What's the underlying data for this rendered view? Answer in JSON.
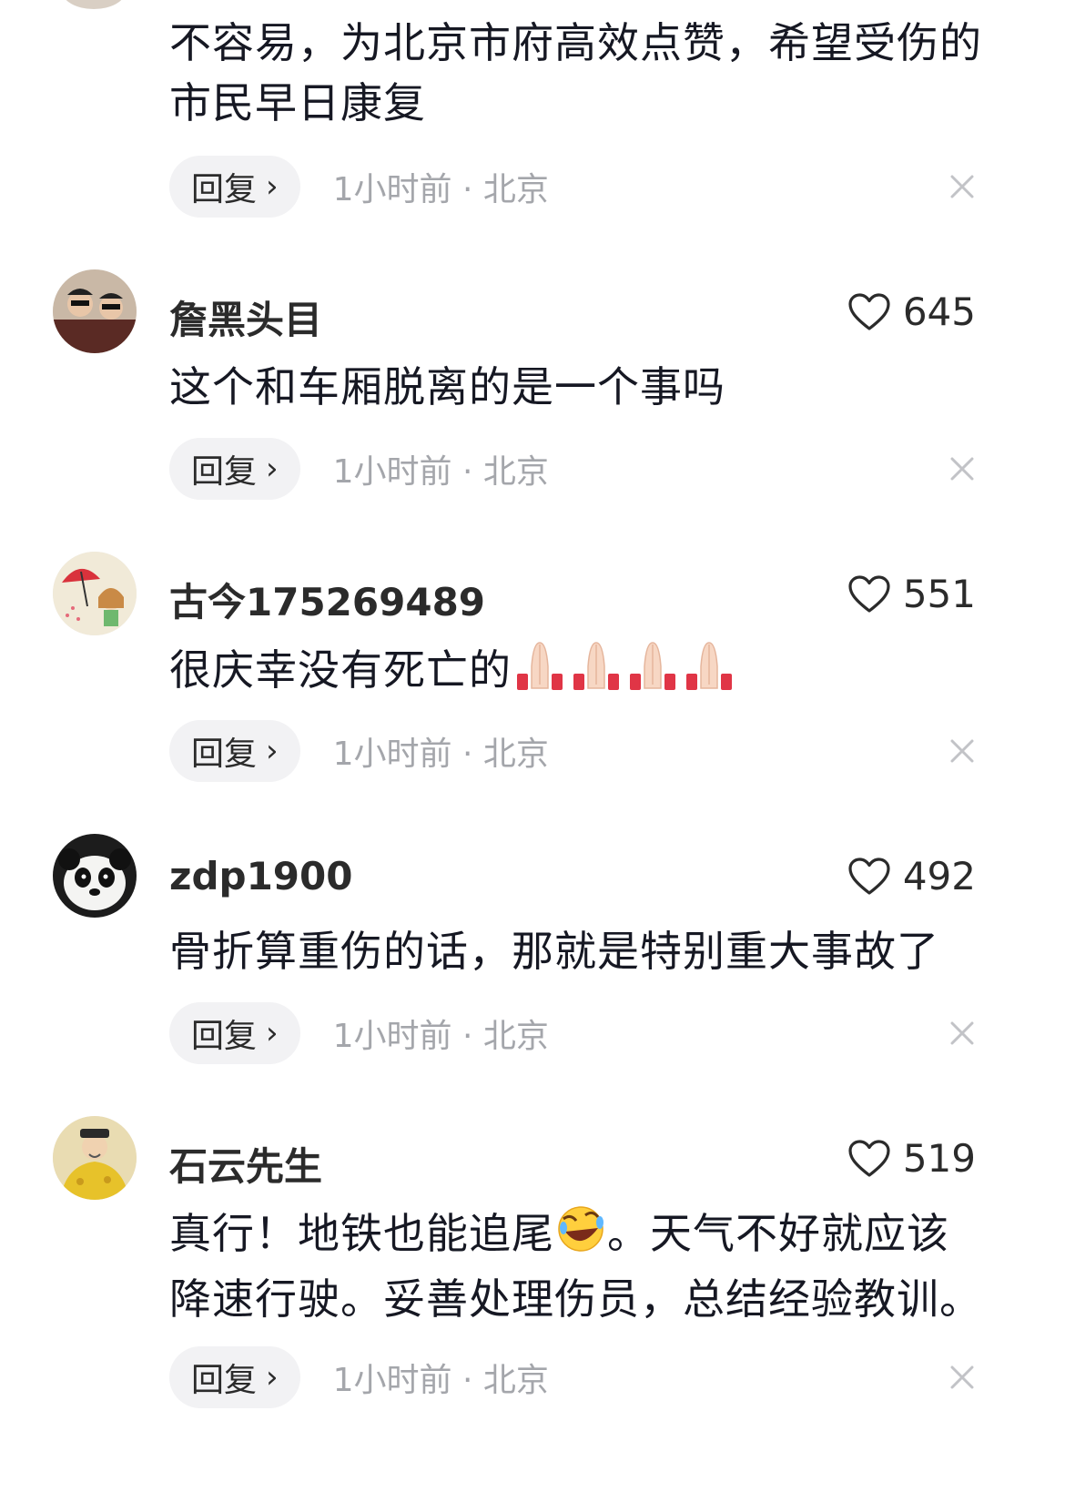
{
  "reply_label": "回复",
  "chevron_glyph": "›",
  "comments": [
    {
      "username": "",
      "likes": "",
      "text": "不容易，为北京市府高效点赞，希望受伤的市民早日康复",
      "time_location": "1小时前 · 北京"
    },
    {
      "username": "詹黑头目",
      "likes": "645",
      "text": "这个和车厢脱离的是一个事吗",
      "time_location": "1小时前 · 北京",
      "avatar": "two-people-sunglasses-avatar"
    },
    {
      "username": "古今175269489",
      "likes": "551",
      "text": "很庆幸没有死亡的",
      "emoji": "folded-hands-icon",
      "emoji_count": 4,
      "time_location": "1小时前 · 北京",
      "avatar": "umbrella-girl-avatar"
    },
    {
      "username": "zdp1900",
      "likes": "492",
      "text": "骨折算重伤的话，那就是特别重大事故了",
      "time_location": "1小时前 · 北京",
      "avatar": "panda-avatar"
    },
    {
      "username": "石云先生",
      "likes": "519",
      "text_before_emoji": "真行！地铁也能追尾",
      "emoji": "rolling-laughing-icon",
      "text_after_emoji": "。天气不好就应该降速行驶。妥善处理伤员，总结经验教训。",
      "time_location": "1小时前 · 北京",
      "avatar": "yellow-robe-emperor-avatar"
    }
  ],
  "colors": {
    "text": "#161823",
    "meta": "#a4a6ab",
    "reply_bg": "#f2f2f4"
  }
}
